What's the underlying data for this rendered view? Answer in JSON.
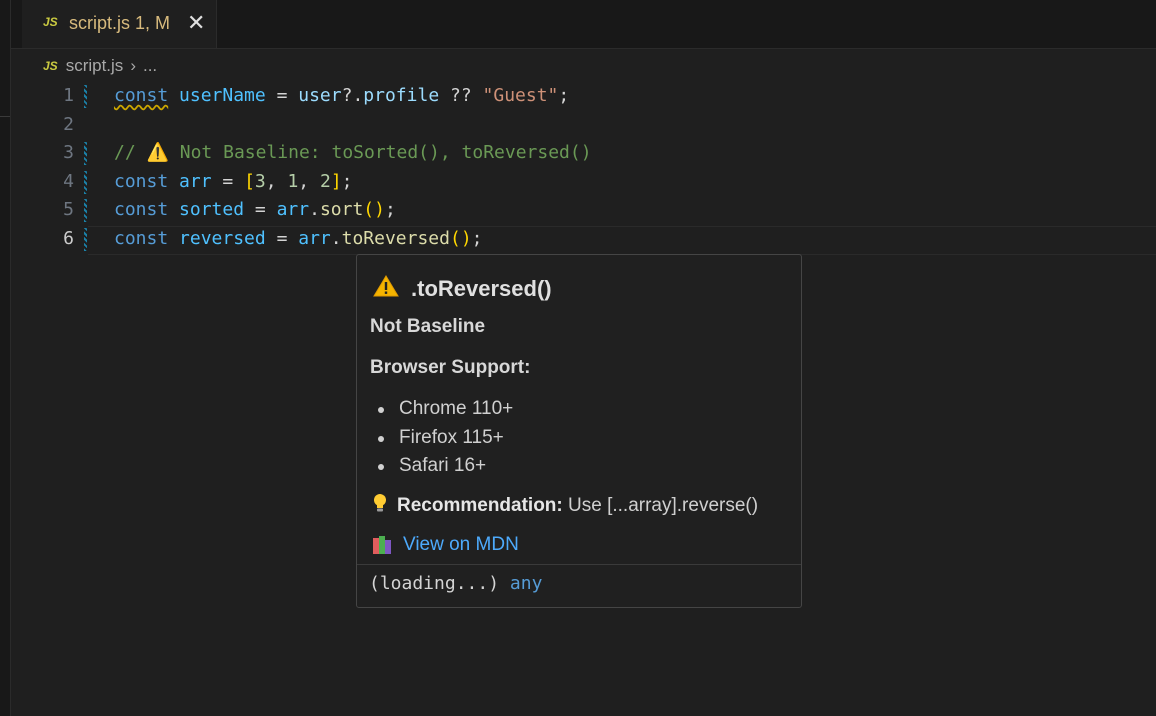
{
  "tab": {
    "icon": "JS",
    "label": "script.js 1, M",
    "close": "✕"
  },
  "breadcrumb": {
    "icon": "JS",
    "file": "script.js",
    "sep": "›",
    "rest": "..."
  },
  "lines": [
    {
      "num": "1",
      "tokens": [
        "const",
        " ",
        "userName",
        " = ",
        "user",
        "?.",
        "profile",
        " ?? ",
        "\"Guest\"",
        ";"
      ]
    },
    {
      "num": "2"
    },
    {
      "num": "3",
      "comment": "// ⚠️ Not Baseline: toSorted(), toReversed()"
    },
    {
      "num": "4",
      "tokens": [
        "const",
        " ",
        "arr",
        " = ",
        "[",
        "3",
        ", ",
        "1",
        ", ",
        "2",
        "]",
        ";"
      ]
    },
    {
      "num": "5",
      "tokens": [
        "const",
        " ",
        "sorted",
        " = ",
        "arr",
        ".",
        "sort",
        "(",
        ")",
        ";"
      ]
    },
    {
      "num": "6",
      "tokens": [
        "const",
        " ",
        "reversed",
        " = ",
        "arr",
        ".",
        "toReversed",
        "(",
        ")",
        ";"
      ]
    }
  ],
  "hover": {
    "title": ".toReversed()",
    "status": "Not Baseline",
    "support_heading": "Browser Support:",
    "browsers": [
      "Chrome 110+",
      "Firefox 115+",
      "Safari 16+"
    ],
    "rec_label": "Recommendation:",
    "rec_text": " Use [...array].reverse()",
    "link": "View on MDN",
    "footer_paren": "(loading...)",
    "footer_type": "any"
  },
  "icons": {
    "warning": "warning-icon",
    "bulb": "lightbulb-icon",
    "books": "books-icon"
  },
  "colors": {
    "keyword": "#569cd6",
    "string": "#ce9178",
    "comment": "#6a9955",
    "link": "#4daafc",
    "tab_modified": "#d7ba7d"
  }
}
